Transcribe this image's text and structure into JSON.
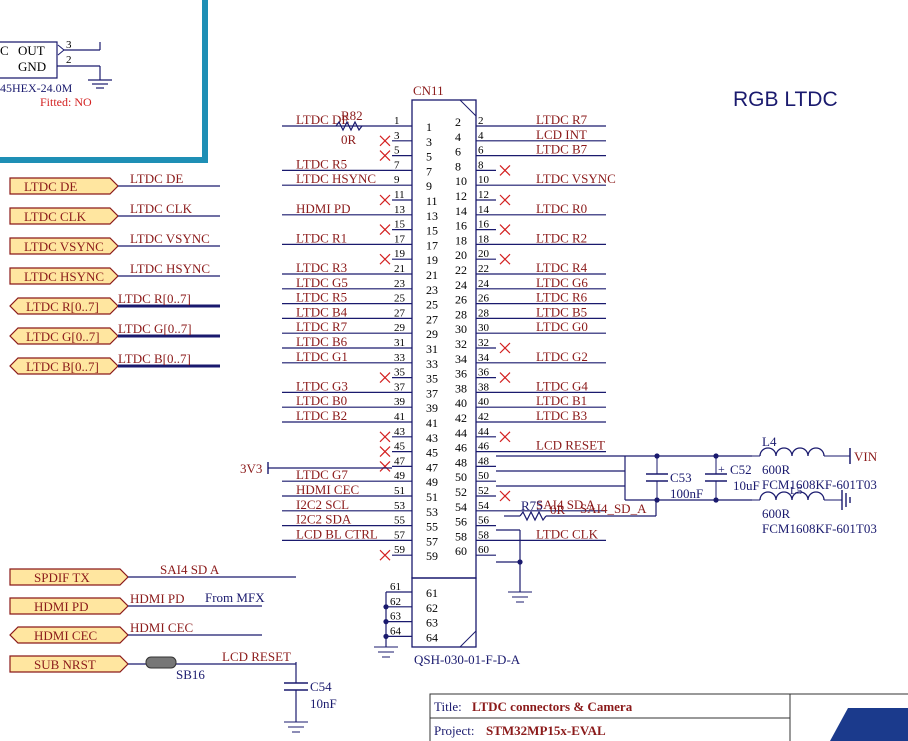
{
  "colors": {
    "wire": "#1a1a6e",
    "net": "#8b1a1a",
    "part": "#8b1a1a",
    "body": "#1a1a6e",
    "border": "#1e8fb5",
    "fitted": "#d32020"
  },
  "heading": "RGB LTDC",
  "connector": {
    "ref": "CN11",
    "part_number": "QSH-030-01-F-D-A",
    "pins_a": [
      "1",
      "3",
      "5",
      "7",
      "9",
      "11",
      "13",
      "15",
      "17",
      "19",
      "21",
      "23",
      "25",
      "27",
      "29",
      "31",
      "33",
      "35",
      "37",
      "39",
      "41",
      "43",
      "45",
      "47",
      "49",
      "51",
      "53",
      "55",
      "57",
      "59"
    ],
    "pins_b": [
      "2",
      "4",
      "6",
      "8",
      "10",
      "12",
      "14",
      "16",
      "18",
      "20",
      "22",
      "24",
      "26",
      "28",
      "30",
      "32",
      "34",
      "36",
      "38",
      "40",
      "42",
      "44",
      "46",
      "48",
      "50",
      "52",
      "54",
      "56",
      "58",
      "60"
    ],
    "left_nets": [
      "LTDC_DE",
      "",
      "",
      "LTDC_R5",
      "LTDC_HSYNC",
      "",
      "HDMI_PD",
      "",
      "LTDC_R1",
      "",
      "LTDC_R3",
      "LTDC_G5",
      "LTDC_R5",
      "LTDC_B4",
      "LTDC_R7",
      "LTDC_B6",
      "LTDC_G1",
      "",
      "LTDC_G3",
      "LTDC_B0",
      "LTDC_B2",
      "",
      "",
      "",
      "LTDC_G7",
      "HDMI_CEC",
      "I2C2_SCL",
      "I2C2_SDA",
      "LCD_BL_CTRL",
      ""
    ],
    "right_nets": [
      "LTDC_R7",
      "LCD_INT",
      "LTDC_B7",
      "",
      "LTDC_VSYNC",
      "",
      "LTDC_R0",
      "",
      "LTDC_R2",
      "",
      "LTDC_R4",
      "LTDC_G6",
      "LTDC_R6",
      "LTDC_B5",
      "LTDC_G0",
      "",
      "LTDC_G2",
      "",
      "LTDC_G4",
      "LTDC_B1",
      "LTDC_B3",
      "",
      "LCD_RESET",
      "",
      "",
      "",
      "SAI4_SD_A",
      "",
      "LTDC_CLK",
      ""
    ],
    "mount_pins": [
      "61",
      "62",
      "63",
      "64"
    ]
  },
  "ports": [
    {
      "label": "LTDC_DE",
      "net": "LTDC_DE"
    },
    {
      "label": "LTDC_CLK",
      "net": "LTDC_CLK"
    },
    {
      "label": "LTDC_VSYNC",
      "net": "LTDC_VSYNC"
    },
    {
      "label": "LTDC_HSYNC",
      "net": "LTDC_HSYNC"
    },
    {
      "label": "LTDC_R[0..7]",
      "net": "LTDC_R[0..7]"
    },
    {
      "label": "LTDC_G[0..7]",
      "net": "LTDC_G[0..7]"
    },
    {
      "label": "LTDC_B[0..7]",
      "net": "LTDC_B[0..7]"
    }
  ],
  "bottom_ports": [
    {
      "label": "SPDIF_TX",
      "net": "SAI4_SD_A"
    },
    {
      "label": "HDMI_PD",
      "net": "HDMI_PD"
    },
    {
      "label": "HDMI_CEC",
      "net": "HDMI_CEC"
    },
    {
      "label": "SUB_NRST",
      "net": "LCD_RESET"
    }
  ],
  "from_mfx": "From MFX",
  "oscillator": {
    "out": "OUT",
    "gnd": "GND",
    "pin3": "3",
    "pin2": "2",
    "part": "45HEX-24.0M",
    "fitted": "Fitted: NO",
    "c": "C"
  },
  "r82": {
    "ref": "R82",
    "value": "0R"
  },
  "r75": {
    "ref": "R75",
    "value": "0R"
  },
  "sb16": "SB16",
  "power_3v3": "3V3",
  "vin": "VIN",
  "c53": {
    "ref": "C53",
    "value": "100nF"
  },
  "c52": {
    "ref": "C52",
    "value": "10uF"
  },
  "l4": {
    "ref": "L4",
    "value": "600R",
    "part": "FCM1608KF-601T03"
  },
  "l5": {
    "ref": "L5",
    "value": "600R",
    "part": "FCM1608KF-601T03"
  },
  "c54": {
    "ref": "C54",
    "value": "10nF"
  },
  "title_block": {
    "title_label": "Title:",
    "title": "LTDC connectors & Camera",
    "project_label": "Project:",
    "project": "STM32MP15x-EVAL"
  }
}
